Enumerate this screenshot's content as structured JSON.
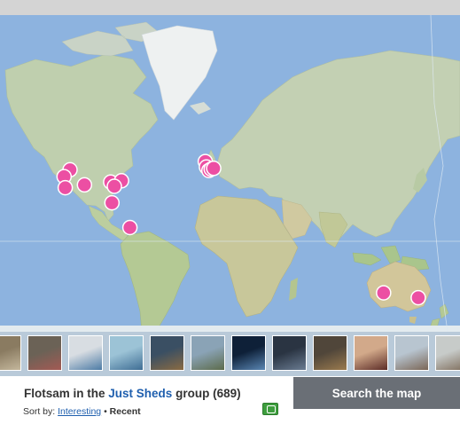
{
  "group": {
    "prefix": "Flotsam in the",
    "name": "Just Sheds",
    "suffix": "group",
    "count": "(689)"
  },
  "sort": {
    "label": "Sort by:",
    "option_interesting": "Interesting",
    "separator": "•",
    "option_recent": "Recent"
  },
  "search_button": "Search the map",
  "map": {
    "marker_color": "#ec4fa3",
    "markers": [
      {
        "name": "marker-canada-west",
        "lon": -117,
        "lat": 52
      },
      {
        "name": "marker-seattle",
        "lon": -122,
        "lat": 47
      },
      {
        "name": "marker-california",
        "lon": -121,
        "lat": 39
      },
      {
        "name": "marker-colorado",
        "lon": -105,
        "lat": 41
      },
      {
        "name": "marker-great-lakes",
        "lon": -83,
        "lat": 43
      },
      {
        "name": "marker-new-england",
        "lon": -74,
        "lat": 44
      },
      {
        "name": "marker-ohio",
        "lon": -80,
        "lat": 40
      },
      {
        "name": "marker-florida",
        "lon": -82,
        "lat": 28
      },
      {
        "name": "marker-venezuela",
        "lon": -67,
        "lat": 10
      },
      {
        "name": "marker-scotland",
        "lon": -4,
        "lat": 58
      },
      {
        "name": "marker-england-north",
        "lon": -3,
        "lat": 54
      },
      {
        "name": "marker-england-south",
        "lon": -1,
        "lat": 51.5
      },
      {
        "name": "marker-london",
        "lon": 1,
        "lat": 52.5
      },
      {
        "name": "marker-netherlands",
        "lon": 3,
        "lat": 53
      },
      {
        "name": "marker-melbourne",
        "lon": 145,
        "lat": -37.5
      },
      {
        "name": "marker-new-zealand",
        "lon": 174,
        "lat": -41
      }
    ]
  },
  "thumbnails": [
    {
      "name": "thumb-shed-1",
      "colors": [
        "#8a7b61",
        "#c4b79c"
      ]
    },
    {
      "name": "thumb-couple",
      "colors": [
        "#6b6256",
        "#a35a54"
      ]
    },
    {
      "name": "thumb-blue-shed",
      "colors": [
        "#d8dde2",
        "#4c7ba5"
      ]
    },
    {
      "name": "thumb-blue-hut",
      "colors": [
        "#9cc3d6",
        "#3e6d94"
      ]
    },
    {
      "name": "thumb-interior",
      "colors": [
        "#3a4f63",
        "#8a6a42"
      ]
    },
    {
      "name": "thumb-roof",
      "colors": [
        "#8aa3b6",
        "#5c6b4b"
      ]
    },
    {
      "name": "thumb-night",
      "colors": [
        "#0e2038",
        "#5a86b3"
      ]
    },
    {
      "name": "thumb-dark-shed",
      "colors": [
        "#2a3442",
        "#6a7c92"
      ]
    },
    {
      "name": "thumb-workshop",
      "colors": [
        "#50463a",
        "#9a7a4e"
      ]
    },
    {
      "name": "thumb-doorway",
      "colors": [
        "#d2a98a",
        "#5b2b26"
      ]
    },
    {
      "name": "thumb-huts",
      "colors": [
        "#b8c5d0",
        "#7a6656"
      ]
    },
    {
      "name": "thumb-garden-shed",
      "colors": [
        "#c7cbc9",
        "#7c6a58"
      ]
    }
  ]
}
